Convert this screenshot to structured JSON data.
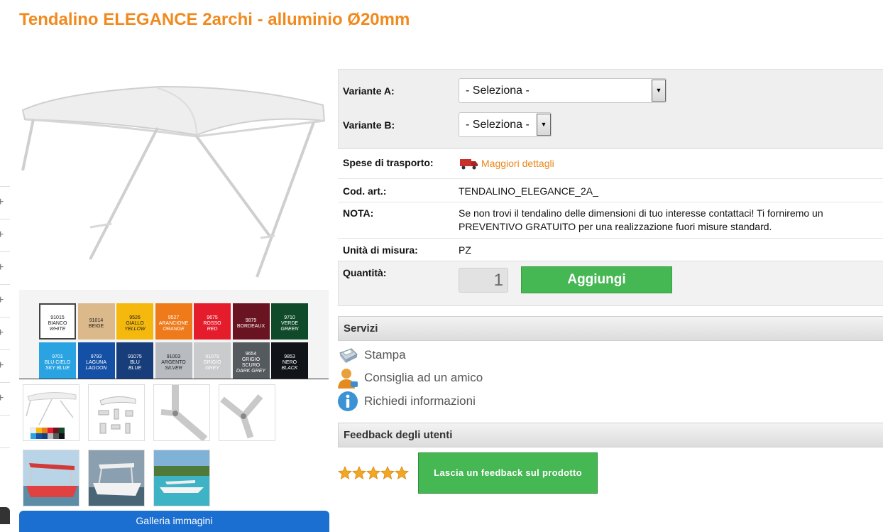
{
  "product": {
    "title": "Tendalino ELEGANCE 2archi - alluminio Ø20mm"
  },
  "colors": {
    "accent_orange": "#f18a1d",
    "button_green": "#45b753",
    "gallery_blue": "#1b6fd0"
  },
  "swatches": [
    {
      "code": "91015",
      "it": "BIANCO",
      "en": "WHITE",
      "color": "#ffffff",
      "text": "#222"
    },
    {
      "code": "91014",
      "it": "BEIGE",
      "en": "",
      "color": "#dcb98a",
      "text": "#222"
    },
    {
      "code": "9526",
      "it": "GIALLO",
      "en": "YELLOW",
      "color": "#f5b80c",
      "text": "#222"
    },
    {
      "code": "9527",
      "it": "ARANCIONE",
      "en": "ORANGE",
      "color": "#ee7a1a",
      "text": "#fff"
    },
    {
      "code": "9675",
      "it": "ROSSO",
      "en": "RED",
      "color": "#e41c2c",
      "text": "#fff"
    },
    {
      "code": "9879",
      "it": "BORDEAUX",
      "en": "",
      "color": "#6a1422",
      "text": "#fff"
    },
    {
      "code": "9710",
      "it": "VERDE",
      "en": "GREEN",
      "color": "#0f4a2a",
      "text": "#fff"
    },
    {
      "code": "9701",
      "it": "BLU CIELO",
      "en": "SKY BLUE",
      "color": "#2aa3e2",
      "text": "#fff"
    },
    {
      "code": "9793",
      "it": "LAGUNA",
      "en": "LAGOON",
      "color": "#1450a5",
      "text": "#fff"
    },
    {
      "code": "91075",
      "it": "BLU",
      "en": "BLUE",
      "color": "#173e7a",
      "text": "#fff"
    },
    {
      "code": "91003",
      "it": "ARGENTO",
      "en": "SILVER",
      "color": "#b8bcc0",
      "text": "#222"
    },
    {
      "code": "91079",
      "it": "GRIGIO",
      "en": "GREY",
      "color": "#c9cbcc",
      "text": "#fff"
    },
    {
      "code": "9654",
      "it": "GRIGIO SCURO",
      "en": "DARK GREY",
      "color": "#555a5e",
      "text": "#fff"
    },
    {
      "code": "9853",
      "it": "NERO",
      "en": "BLACK",
      "color": "#101318",
      "text": "#fff"
    }
  ],
  "gallery": {
    "button_label": "Galleria immagini"
  },
  "variants": {
    "a_label": "Variante A:",
    "a_value": "- Seleziona -",
    "b_label": "Variante B:",
    "b_value": "- Seleziona -"
  },
  "details": {
    "shipping_label": "Spese di trasporto:",
    "shipping_link": "Maggiori dettagli",
    "code_label": "Cod. art.:",
    "code_value": "TENDALINO_ELEGANCE_2A_",
    "note_label": "NOTA:",
    "note_value": "Se non trovi il tendalino delle dimensioni di tuo interesse contattaci! Ti forniremo un PREVENTIVO GRATUITO per una realizzazione fuori misure standard.",
    "unit_label": "Unità di misura:",
    "unit_value": "PZ",
    "qty_label": "Quantità:",
    "qty_value": "1",
    "add_label": "Aggiungi"
  },
  "services": {
    "title": "Servizi",
    "items": [
      {
        "label": "Stampa",
        "icon": "printer-icon"
      },
      {
        "label": "Consiglia ad un amico",
        "icon": "user-icon"
      },
      {
        "label": "Richiedi informazioni",
        "icon": "info-icon"
      }
    ]
  },
  "feedback": {
    "title": "Feedback degli utenti",
    "rating_stars": 5,
    "button_label": "Lascia un feedback sul prodotto"
  }
}
